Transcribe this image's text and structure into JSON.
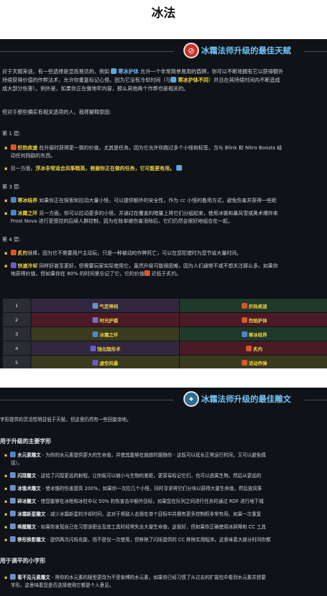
{
  "page": {
    "title": "冰法"
  },
  "panel1": {
    "header": "冰霜法师升级的最佳天赋",
    "intro": [
      "对于天赋来说，有一些选择是显而易见的，例如 ",
      "寒冰护体",
      " 允许一个非常简单易用的盾牌，你可以不断地拥有它以获得额外",
      "持续获得价值的作弊法术，允许你重复标记心怪。因为它没有冷却时间（与",
      "寒冰护体不同",
      "）并且在其持续时间内不断造成",
      "成大部分伤害）。例外是，如果你正在做地牢内容，那么其他两个作弊也是相关的。"
    ],
    "explain": "但对于那些确实有相关选项的人，我将解释原因:",
    "tier1": {
      "label": "第 1 层:",
      "b1_name": "炽热疾速",
      "b1_text": "在升级时获得更一致的价值，尤其是任务。因为它允许你跑过多个小怪和标签，当与 Blink 和 Nitro Boosts 结",
      "b1_text2": "动任何挡路的东西。",
      "b2_pre": "另一方面，",
      "b2_hl": "浮冰非常适合风筝精英，根据你正在做的任务，它可能更有用。"
    },
    "tier3": {
      "label": "第 3 层:",
      "b1_name": "寒冰结界",
      "b1_text": "如果你正在探索和拉动大量小怪，可以提供额外的安全性，作为 cc 小怪的备用方式，避免伤害并获得一些距",
      "b2_name": "冰霜之环",
      "b2_text": "另一方面，你可以拉动更多的小怪，并通过在覆盖的暗量上将它们分组起来，使用冰锥和暴风雪或奥术爆炸来",
      "b2_text2": "Frost Nova 进行更受控的后续人群控制，因为在账单被伤害消除后，它们仍然会很好地组合在一起。"
    },
    "tier4": {
      "label": "第 4 层:",
      "b1_name": "炙灼",
      "b1_text": "很棒，因为它不需要用户主动玩，只是一种被动的作弊死亡，可以在您犯错时为您节省大量时间。",
      "b2_name": "快速冷却",
      "b2_text": "同样好甚至更好，但需要玩家实际使用它，虽然升级可能很困难，因为人们通常不或不想关注那么多。如果你",
      "b2_text2": "地获得价值，但如果你在 80% 的时间里忘记了它，它的价值",
      "b2_mid": "近低于炙灼。"
    },
    "table": {
      "rows": [
        {
          "num": "1",
          "left": "气定神闲",
          "right": "炽热疾速"
        },
        {
          "num": "2",
          "left": "时光护盾",
          "right": "烈焰护体"
        },
        {
          "num": "3",
          "left": "冰霜之环",
          "right": "寒冰结界"
        },
        {
          "num": "4",
          "left": "强化隐形术",
          "right": "炙灼"
        },
        {
          "num": "5",
          "left": "虚空风暴",
          "right": "活动炸弹"
        }
      ]
    }
  },
  "panel2": {
    "header": "冰霜法师升级的最佳雕文",
    "intro": "字形提供的灵活性明显低于天赋，但这里仍然有一些回旋余地。",
    "major_heading": "用于升级的主要字形",
    "major": [
      {
        "name": "水元素雕文",
        "text": " - 为你的水元素提供更大的生命值，并使其能够在施放时跟随你 - 这既可以延长正常运行时间，又可以避免偶"
      },
      {
        "name": "",
        "text": "话）。"
      },
      {
        "name": "闪现雕文",
        "text": " - 这给了闪现更远的射程，让你既可以缩小与生物的差距，更容易标记它们，也可以逃离生物，然后从更远的"
      },
      {
        "name": "冰锥术雕文",
        "text": " - 使冰锥的伤害提高 200%，如果你一次拉几个小怪，同时寻求将它们分块以获得大量生命值，然后放风筝"
      },
      {
        "name": "碎冰雕文",
        "text": " - 使您能够在冰枪和冰柱中以 50% 的伤害击中额外目标，如果您在队列之间进行任务时通过 RDF 进行地下城"
      },
      {
        "name": "冰霜新星雕文",
        "text": " - 减少冰霜新星的冷却时间，这对于将敌人击倒在单个目标中并拥有更多控制权非常有用，如果一次重复"
      },
      {
        "name": "唤醒雕文",
        "text": " - 如果你发现自己在习惯该职业及其工具时经常失去大量生命值，这很好，但如果你正确使用冰屏障和 CC 工具"
      },
      {
        "name": "移形换影雕文",
        "text": " - 提供两次闪烁充能，而不是仅一次使用，但移除了闪烁提供的 CC 移除实用程序。这意味着大部分时间你都"
      }
    ],
    "minor_heading": "用于调平的小字形",
    "minor": [
      {
        "name": "看不见元素雕文",
        "text": " - 将你的水元素的模型更改为不受束缚的水元素，如果你已经习惯了从过去的扩展包中看到水元素并想要"
      },
      {
        "name": "",
        "text": "字形，这意味着您是否选择使用它都是个人意见。"
      }
    ],
    "colors": {
      "accent": "#6fc3f5",
      "bg": "#0f1217",
      "highlight": "#f2d33f"
    }
  }
}
